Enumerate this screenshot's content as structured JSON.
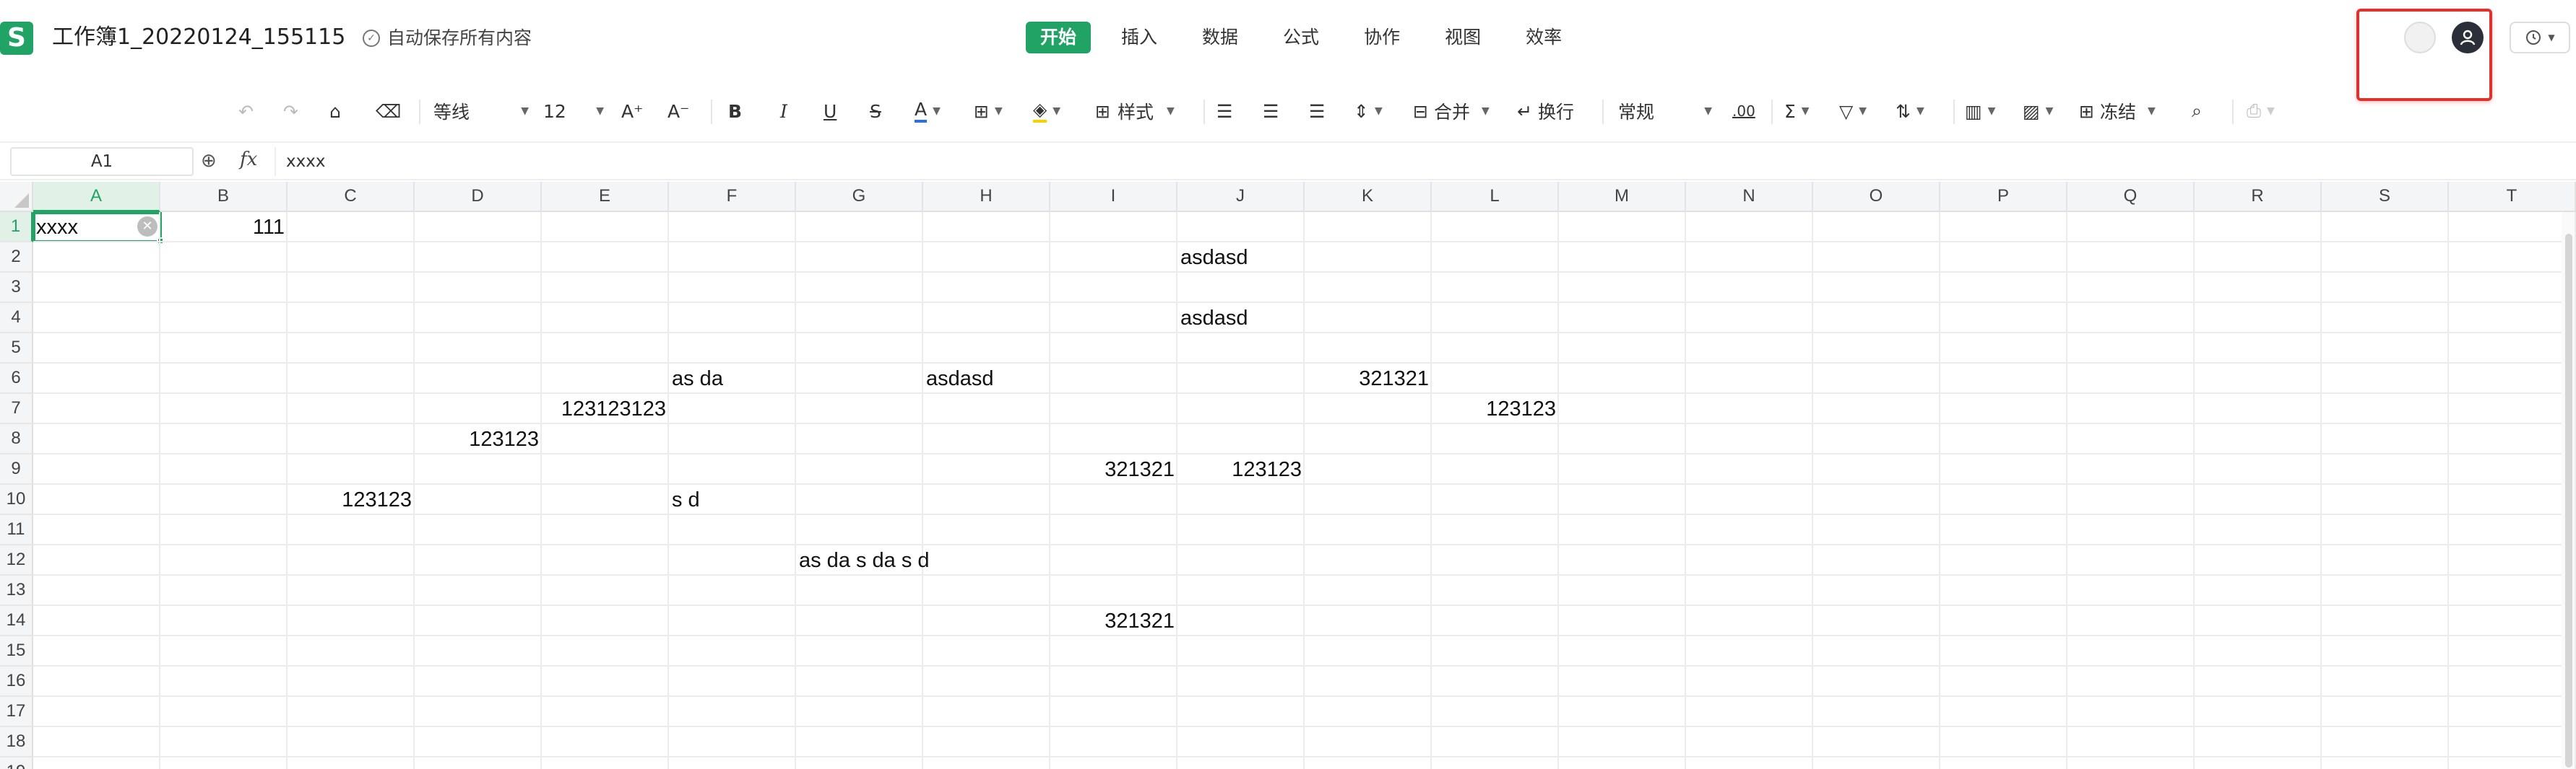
{
  "app": {
    "logo_letter": "S",
    "doc_title": "工作簿1_20220124_155115",
    "autosave": "自动保存所有内容",
    "accent_color": "#21a366"
  },
  "menu": {
    "items": [
      "开始",
      "插入",
      "数据",
      "公式",
      "协作",
      "视图",
      "效率"
    ],
    "active_index": 0
  },
  "toolbar": {
    "font_name": "等线",
    "font_size": "12",
    "style_label": "样式",
    "merge_label": "合并",
    "wrap_label": "换行",
    "format_label": "常规",
    "decimal_label": ".00",
    "freeze_label": "冻结",
    "bold": "B",
    "italic": "I",
    "underline": "U",
    "strike": "S",
    "font_color": "A",
    "grow": "A⁺",
    "shrink": "A⁻"
  },
  "formula_bar": {
    "name_box": "A1",
    "fx_label": "fx",
    "value": "xxxx"
  },
  "grid": {
    "columns": [
      "A",
      "B",
      "C",
      "D",
      "E",
      "F",
      "G",
      "H",
      "I",
      "J",
      "K",
      "L",
      "M",
      "N",
      "O",
      "P",
      "Q",
      "R",
      "S",
      "T"
    ],
    "rows": [
      "1",
      "2",
      "3",
      "4",
      "5",
      "6",
      "7",
      "8",
      "9",
      "10",
      "11",
      "12",
      "13",
      "14",
      "15",
      "16",
      "17",
      "18",
      "19"
    ],
    "selected_col": "A",
    "selected_row": "1",
    "cells": [
      {
        "col": "A",
        "row": 1,
        "value": "xxxx",
        "align": "l"
      },
      {
        "col": "B",
        "row": 1,
        "value": "111",
        "align": "r"
      },
      {
        "col": "J",
        "row": 2,
        "value": "asdasd",
        "align": "l"
      },
      {
        "col": "J",
        "row": 4,
        "value": "asdasd",
        "align": "l"
      },
      {
        "col": "F",
        "row": 6,
        "value": "as da",
        "align": "l"
      },
      {
        "col": "H",
        "row": 6,
        "value": "asdasd",
        "align": "l"
      },
      {
        "col": "K",
        "row": 6,
        "value": "321321",
        "align": "r"
      },
      {
        "col": "E",
        "row": 7,
        "value": "123123123",
        "align": "r"
      },
      {
        "col": "L",
        "row": 7,
        "value": "123123",
        "align": "r"
      },
      {
        "col": "D",
        "row": 8,
        "value": "123123",
        "align": "r"
      },
      {
        "col": "I",
        "row": 9,
        "value": "321321",
        "align": "r"
      },
      {
        "col": "J",
        "row": 9,
        "value": "123123",
        "align": "r"
      },
      {
        "col": "C",
        "row": 10,
        "value": "123123",
        "align": "r"
      },
      {
        "col": "F",
        "row": 10,
        "value": "s d",
        "align": "l"
      },
      {
        "col": "G",
        "row": 12,
        "value": "as da s da s d",
        "align": "l"
      },
      {
        "col": "I",
        "row": 14,
        "value": "321321",
        "align": "r"
      }
    ]
  }
}
